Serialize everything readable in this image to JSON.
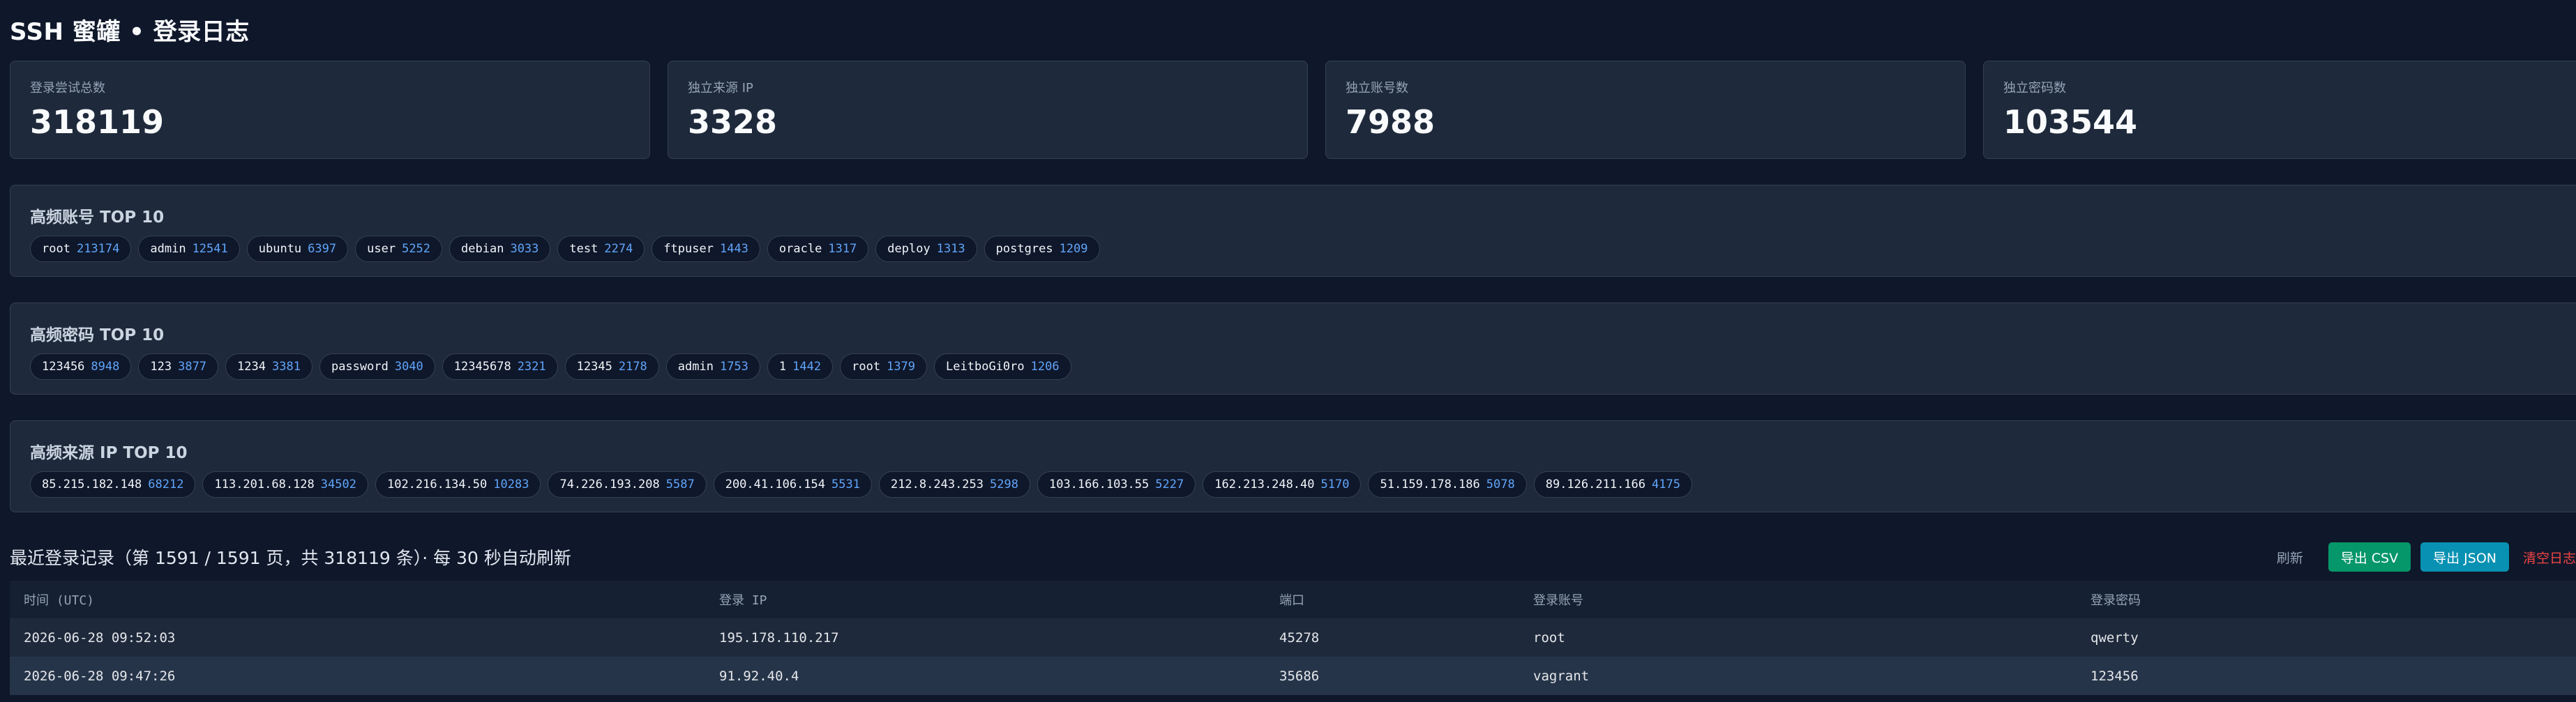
{
  "title": "SSH 蜜罐 • 登录日志",
  "stats": [
    {
      "label": "登录尝试总数",
      "value": "318119"
    },
    {
      "label": "独立来源 IP",
      "value": "3328"
    },
    {
      "label": "独立账号数",
      "value": "7988"
    },
    {
      "label": "独立密码数",
      "value": "103544"
    }
  ],
  "top_accounts": {
    "title": "高频账号 TOP 10",
    "items": [
      {
        "name": "root",
        "count": "213174"
      },
      {
        "name": "admin",
        "count": "12541"
      },
      {
        "name": "ubuntu",
        "count": "6397"
      },
      {
        "name": "user",
        "count": "5252"
      },
      {
        "name": "debian",
        "count": "3033"
      },
      {
        "name": "test",
        "count": "2274"
      },
      {
        "name": "ftpuser",
        "count": "1443"
      },
      {
        "name": "oracle",
        "count": "1317"
      },
      {
        "name": "deploy",
        "count": "1313"
      },
      {
        "name": "postgres",
        "count": "1209"
      }
    ]
  },
  "top_passwords": {
    "title": "高频密码 TOP 10",
    "items": [
      {
        "name": "123456",
        "count": "8948"
      },
      {
        "name": "123",
        "count": "3877"
      },
      {
        "name": "1234",
        "count": "3381"
      },
      {
        "name": "password",
        "count": "3040"
      },
      {
        "name": "12345678",
        "count": "2321"
      },
      {
        "name": "12345",
        "count": "2178"
      },
      {
        "name": "admin",
        "count": "1753"
      },
      {
        "name": "1",
        "count": "1442"
      },
      {
        "name": "root",
        "count": "1379"
      },
      {
        "name": "LeitboGi0ro",
        "count": "1206"
      }
    ]
  },
  "top_ips": {
    "title": "高频来源 IP TOP 10",
    "items": [
      {
        "name": "85.215.182.148",
        "count": "68212"
      },
      {
        "name": "113.201.68.128",
        "count": "34502"
      },
      {
        "name": "102.216.134.50",
        "count": "10283"
      },
      {
        "name": "74.226.193.208",
        "count": "5587"
      },
      {
        "name": "200.41.106.154",
        "count": "5531"
      },
      {
        "name": "212.8.243.253",
        "count": "5298"
      },
      {
        "name": "103.166.103.55",
        "count": "5227"
      },
      {
        "name": "162.213.248.40",
        "count": "5170"
      },
      {
        "name": "51.159.178.186",
        "count": "5078"
      },
      {
        "name": "89.126.211.166",
        "count": "4175"
      }
    ]
  },
  "records": {
    "title": "最近登录记录（第 1591 / 1591 页，共 318119 条）· 每 30 秒自动刷新",
    "refresh_label": "刷新",
    "export_csv_label": "导出 CSV",
    "export_json_label": "导出 JSON",
    "clear_label": "清空日志",
    "columns": [
      "时间 (UTC)",
      "登录 IP",
      "端口",
      "登录账号",
      "登录密码"
    ],
    "rows": [
      [
        "2026-06-28 09:52:03",
        "195.178.110.217",
        "45278",
        "root",
        "qwerty"
      ],
      [
        "2026-06-28 09:47:26",
        "91.92.40.4",
        "35686",
        "vagrant",
        "123456"
      ]
    ]
  },
  "colors": {
    "background": "#0f172a",
    "card": "#1e293b",
    "count_accent": "#60a5fa",
    "csv_button": "#059669",
    "json_button": "#0891b2",
    "danger": "#ef4444"
  }
}
